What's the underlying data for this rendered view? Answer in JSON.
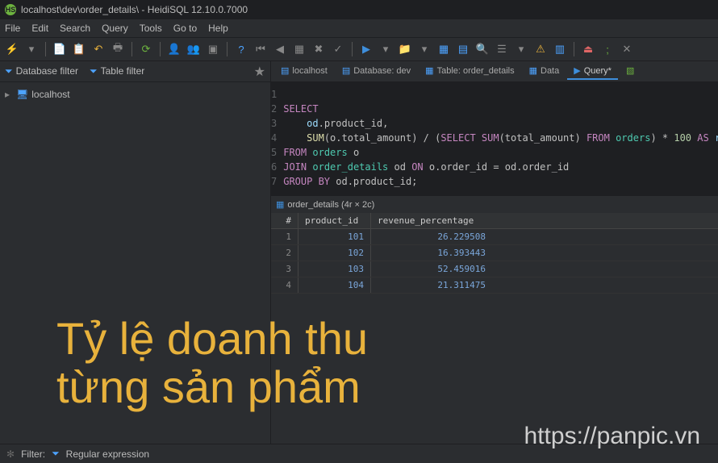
{
  "title": "localhost\\dev\\order_details\\ - HeidiSQL 12.10.0.7000",
  "menu": [
    "File",
    "Edit",
    "Search",
    "Query",
    "Tools",
    "Go to",
    "Help"
  ],
  "filters": {
    "db_label": "Database filter",
    "table_label": "Table filter"
  },
  "tree": {
    "root": "localhost"
  },
  "tabs": {
    "host": "localhost",
    "database": "Database: dev",
    "table": "Table: order_details",
    "data": "Data",
    "query": "Query*"
  },
  "sql": {
    "lines": [
      "1",
      "2",
      "3",
      "4",
      "5",
      "6",
      "7"
    ],
    "l2": "SELECT",
    "l3_a": "od",
    "l3_b": ".product_id,",
    "l4_a": "SUM",
    "l4_b": "(o.total_amount) / (",
    "l4_c": "SELECT SUM",
    "l4_d": "(total_amount) ",
    "l4_e": "FROM",
    "l4_f": " orders",
    "l4_g": ") * ",
    "l4_h": "100",
    "l4_i": " AS",
    "l4_j": " revenue_",
    "l5_a": "FROM",
    "l5_b": " orders",
    "l5_c": " o",
    "l6_a": "JOIN",
    "l6_b": " order_details",
    "l6_c": " od ",
    "l6_d": "ON",
    "l6_e": " o.order_id = od.order_id",
    "l7_a": "GROUP BY",
    "l7_b": " od.product_id;"
  },
  "result": {
    "title": "order_details (4r × 2c)",
    "col_idx": "#",
    "col_pid": "product_id",
    "col_rev": "revenue_percentage",
    "rows": [
      {
        "i": "1",
        "pid": "101",
        "rev": "26.229508"
      },
      {
        "i": "2",
        "pid": "102",
        "rev": "16.393443"
      },
      {
        "i": "3",
        "pid": "103",
        "rev": "52.459016"
      },
      {
        "i": "4",
        "pid": "104",
        "rev": "21.311475"
      }
    ]
  },
  "status": {
    "filter_label": "Filter:",
    "regex_label": "Regular expression"
  },
  "overlay": {
    "title_line1": "Tỷ lệ doanh thu",
    "title_line2": "từng sản phẩm",
    "url": "https://panpic.vn"
  }
}
